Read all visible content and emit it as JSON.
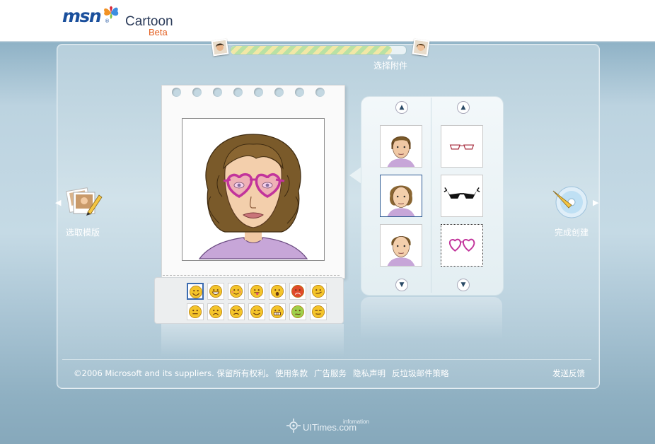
{
  "header": {
    "logo_msn": "msn",
    "logo_tm": "®",
    "product_name": "Cartoon",
    "product_tag": "Beta"
  },
  "progress": {
    "step_label": "选择附件",
    "fraction": 0.92
  },
  "nav": {
    "prev_label": "选取模版",
    "next_label": "完成创建",
    "prev_arrow": "◀",
    "next_arrow": "▶"
  },
  "emotions": {
    "selected_index": 0,
    "row1": [
      "smile",
      "grin",
      "blush",
      "tongue",
      "surprised",
      "angry",
      "smirk"
    ],
    "row2": [
      "neutral",
      "sad",
      "frown",
      "wink",
      "teeth",
      "sick",
      "calm"
    ]
  },
  "accessories": {
    "up_arrow": "▲",
    "down_arrow": "▼",
    "faces_column": [
      "face-variant-1",
      "face-variant-2",
      "face-variant-3"
    ],
    "glasses_column": [
      "thin-red-glasses",
      "black-cateye-glasses",
      "heart-glasses"
    ],
    "selected_face_index": 1,
    "selected_glasses_index": 2
  },
  "footer": {
    "copyright": "©2006 Microsoft and its suppliers. 保留所有权利。",
    "links": [
      "使用条款",
      "广告服务",
      "隐私声明",
      "反垃圾邮件策略"
    ],
    "feedback": "发送反馈"
  },
  "watermark": {
    "text": "UITimes.com",
    "sup": "infomation"
  },
  "colors": {
    "accent": "#1a4f9c",
    "beta": "#e25b1b",
    "glasses": "#c2349b",
    "hair": "#7a5a2a",
    "shirt": "#c7a6d8"
  }
}
